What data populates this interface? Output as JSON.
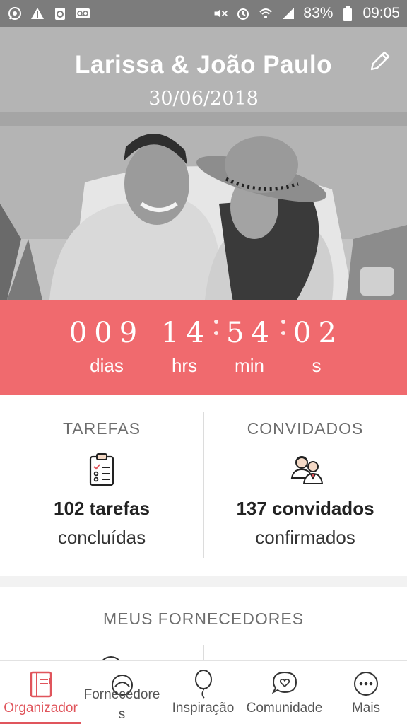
{
  "status_bar": {
    "battery": "83%",
    "time": "09:05",
    "left_icons": [
      "whatsapp-icon",
      "warning-icon",
      "clipboard-icon",
      "voicemail-icon"
    ],
    "right_icons": [
      "mute-icon",
      "alarm-icon",
      "wifi-icon",
      "signal-icon",
      "battery-icon"
    ]
  },
  "hero": {
    "couple_name": "Larissa & João Paulo",
    "wedding_date": "30/06/2018",
    "edit_icon": "pencil-icon"
  },
  "countdown": {
    "days": "009",
    "days_label": "dias",
    "hours": "14",
    "hours_label": "hrs",
    "minutes": "54",
    "minutes_label": "min",
    "seconds": "02",
    "seconds_label": "s"
  },
  "tasks": {
    "title": "TAREFAS",
    "icon": "checklist-icon",
    "count_text": "102 tarefas",
    "sub_text": "concluídas"
  },
  "guests": {
    "title": "CONVIDADOS",
    "icon": "guests-icon",
    "count_text": "137 convidados",
    "sub_text": "confirmados"
  },
  "suppliers": {
    "title": "MEUS FORNECEDORES"
  },
  "bottom_nav": {
    "active_color": "#e0555c",
    "items": [
      {
        "label": "Organizador",
        "icon": "planner-icon",
        "active": true
      },
      {
        "label_line1": "Fornecedore",
        "label_line2": "s",
        "icon": "suppliers-icon"
      },
      {
        "label": "Inspiração",
        "icon": "balloon-icon"
      },
      {
        "label": "Comunidade",
        "icon": "chat-heart-icon"
      },
      {
        "label": "Mais",
        "icon": "more-icon"
      }
    ]
  },
  "colors": {
    "accent": "#f06a6e",
    "status_bar": "#7c7c7c"
  }
}
